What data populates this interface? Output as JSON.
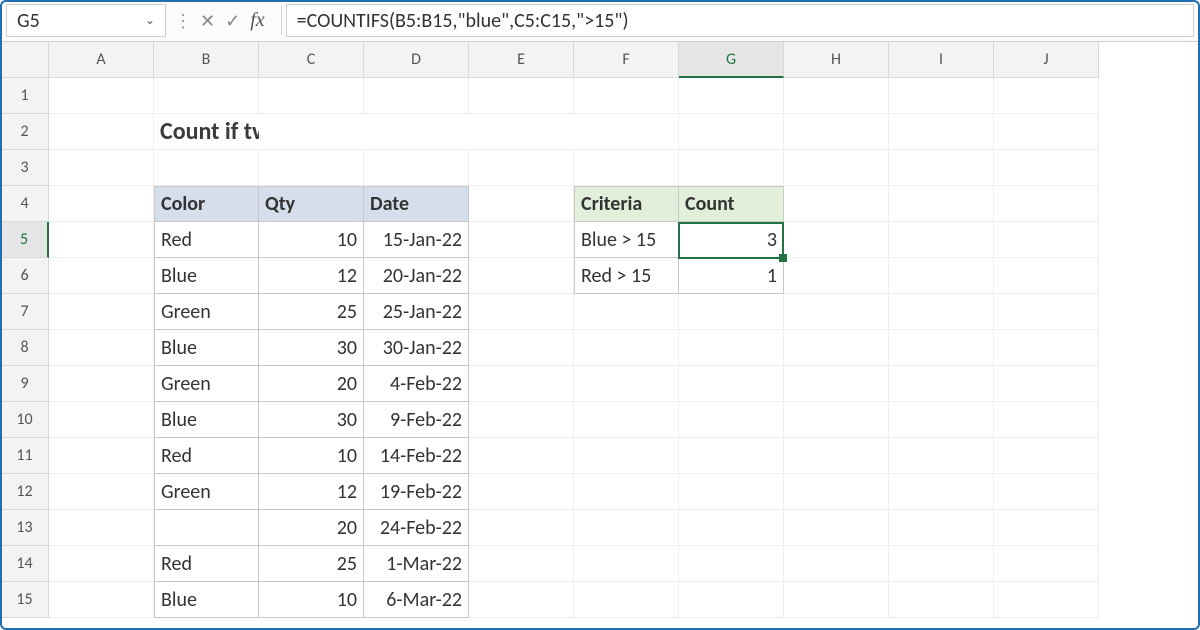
{
  "nameBox": {
    "value": "G5"
  },
  "formulaBar": {
    "formula": "=COUNTIFS(B5:B15,\"blue\",C5:C15,\">15\")"
  },
  "columns": [
    "A",
    "B",
    "C",
    "D",
    "E",
    "F",
    "G",
    "H",
    "I",
    "J"
  ],
  "rows": [
    "1",
    "2",
    "3",
    "4",
    "5",
    "6",
    "7",
    "8",
    "9",
    "10",
    "11",
    "12",
    "13",
    "14",
    "15"
  ],
  "selectedColumn": "G",
  "selectedRowIndex": 4,
  "title": "Count if two criteria match",
  "dataTable": {
    "headers": {
      "color": "Color",
      "qty": "Qty",
      "date": "Date"
    },
    "rows": [
      {
        "color": "Red",
        "qty": "10",
        "date": "15-Jan-22"
      },
      {
        "color": "Blue",
        "qty": "12",
        "date": "20-Jan-22"
      },
      {
        "color": "Green",
        "qty": "25",
        "date": "25-Jan-22"
      },
      {
        "color": "Blue",
        "qty": "30",
        "date": "30-Jan-22"
      },
      {
        "color": "Green",
        "qty": "20",
        "date": "4-Feb-22"
      },
      {
        "color": "Blue",
        "qty": "30",
        "date": "9-Feb-22"
      },
      {
        "color": "Red",
        "qty": "10",
        "date": "14-Feb-22"
      },
      {
        "color": "Green",
        "qty": "12",
        "date": "19-Feb-22"
      },
      {
        "color": "",
        "qty": "20",
        "date": "24-Feb-22"
      },
      {
        "color": "Red",
        "qty": "25",
        "date": "1-Mar-22"
      },
      {
        "color": "Blue",
        "qty": "10",
        "date": "6-Mar-22"
      }
    ]
  },
  "resultTable": {
    "headers": {
      "criteria": "Criteria",
      "count": "Count"
    },
    "rows": [
      {
        "criteria": "Blue > 15",
        "count": "3"
      },
      {
        "criteria": "Red > 15",
        "count": "1"
      }
    ]
  },
  "icons": {
    "chevDown": "⌄",
    "vertDots": "⋮",
    "cancel": "✕",
    "confirm": "✓",
    "fx": "fx"
  }
}
